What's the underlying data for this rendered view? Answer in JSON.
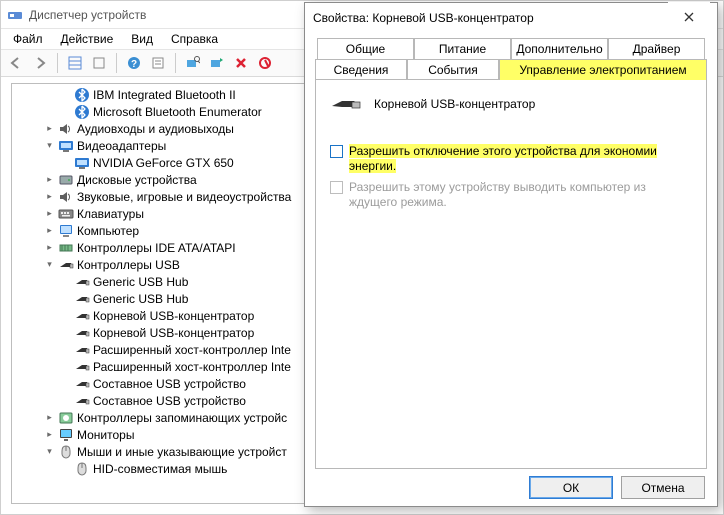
{
  "dm": {
    "title": "Диспетчер устройств",
    "menus": [
      "Файл",
      "Действие",
      "Вид",
      "Справка"
    ]
  },
  "tree": [
    {
      "depth": 3,
      "exp": "",
      "icon": "bluetooth",
      "label": "IBM Integrated Bluetooth II"
    },
    {
      "depth": 3,
      "exp": "",
      "icon": "bluetooth",
      "label": "Microsoft Bluetooth Enumerator"
    },
    {
      "depth": 2,
      "exp": ">",
      "icon": "audio",
      "label": "Аудиовходы и аудиовыходы"
    },
    {
      "depth": 2,
      "exp": "v",
      "icon": "video",
      "label": "Видеоадаптеры"
    },
    {
      "depth": 3,
      "exp": "",
      "icon": "video",
      "label": "NVIDIA GeForce GTX 650"
    },
    {
      "depth": 2,
      "exp": ">",
      "icon": "disk",
      "label": "Дисковые устройства"
    },
    {
      "depth": 2,
      "exp": ">",
      "icon": "audio",
      "label": "Звуковые, игровые и видеоустройства"
    },
    {
      "depth": 2,
      "exp": ">",
      "icon": "keyboard",
      "label": "Клавиатуры"
    },
    {
      "depth": 2,
      "exp": ">",
      "icon": "computer",
      "label": "Компьютер"
    },
    {
      "depth": 2,
      "exp": ">",
      "icon": "ide",
      "label": "Контроллеры IDE ATA/ATAPI"
    },
    {
      "depth": 2,
      "exp": "v",
      "icon": "usb",
      "label": "Контроллеры USB"
    },
    {
      "depth": 3,
      "exp": "",
      "icon": "usb",
      "label": "Generic USB Hub"
    },
    {
      "depth": 3,
      "exp": "",
      "icon": "usb",
      "label": "Generic USB Hub"
    },
    {
      "depth": 3,
      "exp": "",
      "icon": "usb",
      "label": "Корневой USB-концентратор"
    },
    {
      "depth": 3,
      "exp": "",
      "icon": "usb",
      "label": "Корневой USB-концентратор"
    },
    {
      "depth": 3,
      "exp": "",
      "icon": "usb",
      "label": "Расширенный хост-контроллер Inte"
    },
    {
      "depth": 3,
      "exp": "",
      "icon": "usb",
      "label": "Расширенный хост-контроллер Inte"
    },
    {
      "depth": 3,
      "exp": "",
      "icon": "usb",
      "label": "Составное USB устройство"
    },
    {
      "depth": 3,
      "exp": "",
      "icon": "usb",
      "label": "Составное USB устройство"
    },
    {
      "depth": 2,
      "exp": ">",
      "icon": "storage",
      "label": "Контроллеры запоминающих устройс"
    },
    {
      "depth": 2,
      "exp": ">",
      "icon": "monitor",
      "label": "Мониторы"
    },
    {
      "depth": 2,
      "exp": "v",
      "icon": "mouse",
      "label": "Мыши и иные указывающие устройст"
    },
    {
      "depth": 3,
      "exp": "",
      "icon": "mouse",
      "label": "HID-совместимая мышь"
    }
  ],
  "dlg": {
    "title": "Свойства: Корневой USB-концентратор",
    "tabs_top": [
      "Общие",
      "Питание",
      "Дополнительно",
      "Драйвер"
    ],
    "tabs_bot": [
      "Сведения",
      "События",
      "Управление электропитанием"
    ],
    "active_tab": "Управление электропитанием",
    "device_name": "Корневой USB-концентратор",
    "opt1": "Разрешить отключение этого устройства для экономии энергии.",
    "opt2": "Разрешить этому устройству выводить компьютер из ждущего режима.",
    "ok": "ОК",
    "cancel": "Отмена"
  }
}
